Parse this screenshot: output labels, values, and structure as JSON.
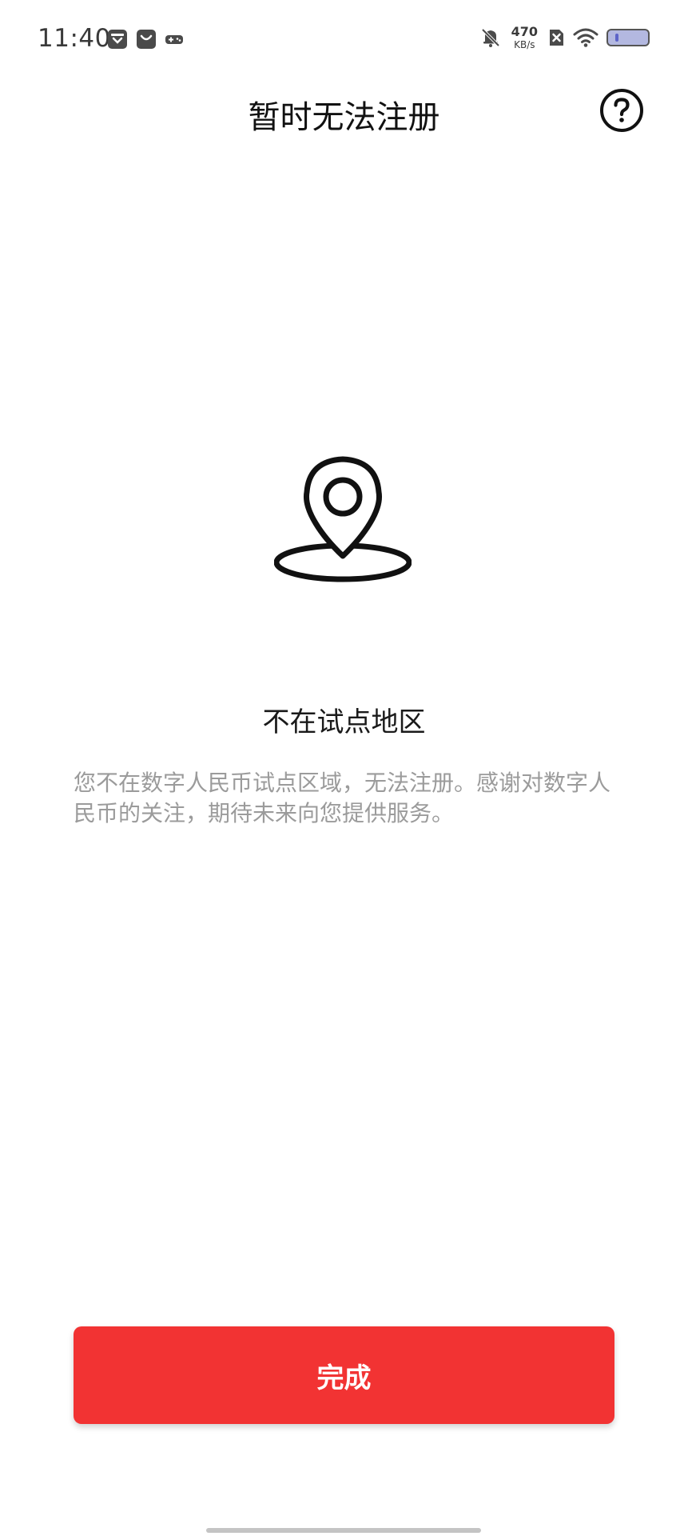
{
  "status_bar": {
    "time": "11:40",
    "net_speed_value": "470",
    "net_speed_unit": "KB/s",
    "left_icons": [
      "inbox-icon",
      "shopping-bag-icon",
      "gamepad-icon"
    ],
    "right_icons": [
      "bell-muted-icon",
      "sim-disabled-icon",
      "wifi-icon",
      "battery-icon"
    ]
  },
  "header": {
    "title": "暂时无法注册",
    "help_icon": "question-circle-icon"
  },
  "main": {
    "icon": "location-pin-icon",
    "heading": "不在试点地区",
    "description": "您不在数字人民币试点区域，无法注册。感谢对数字人民币的关注，期待未来向您提供服务。"
  },
  "footer": {
    "done_label": "完成"
  },
  "colors": {
    "accent": "#f23333",
    "text_primary": "#111111",
    "text_secondary": "#9b9b9b",
    "background": "#ffffff"
  }
}
